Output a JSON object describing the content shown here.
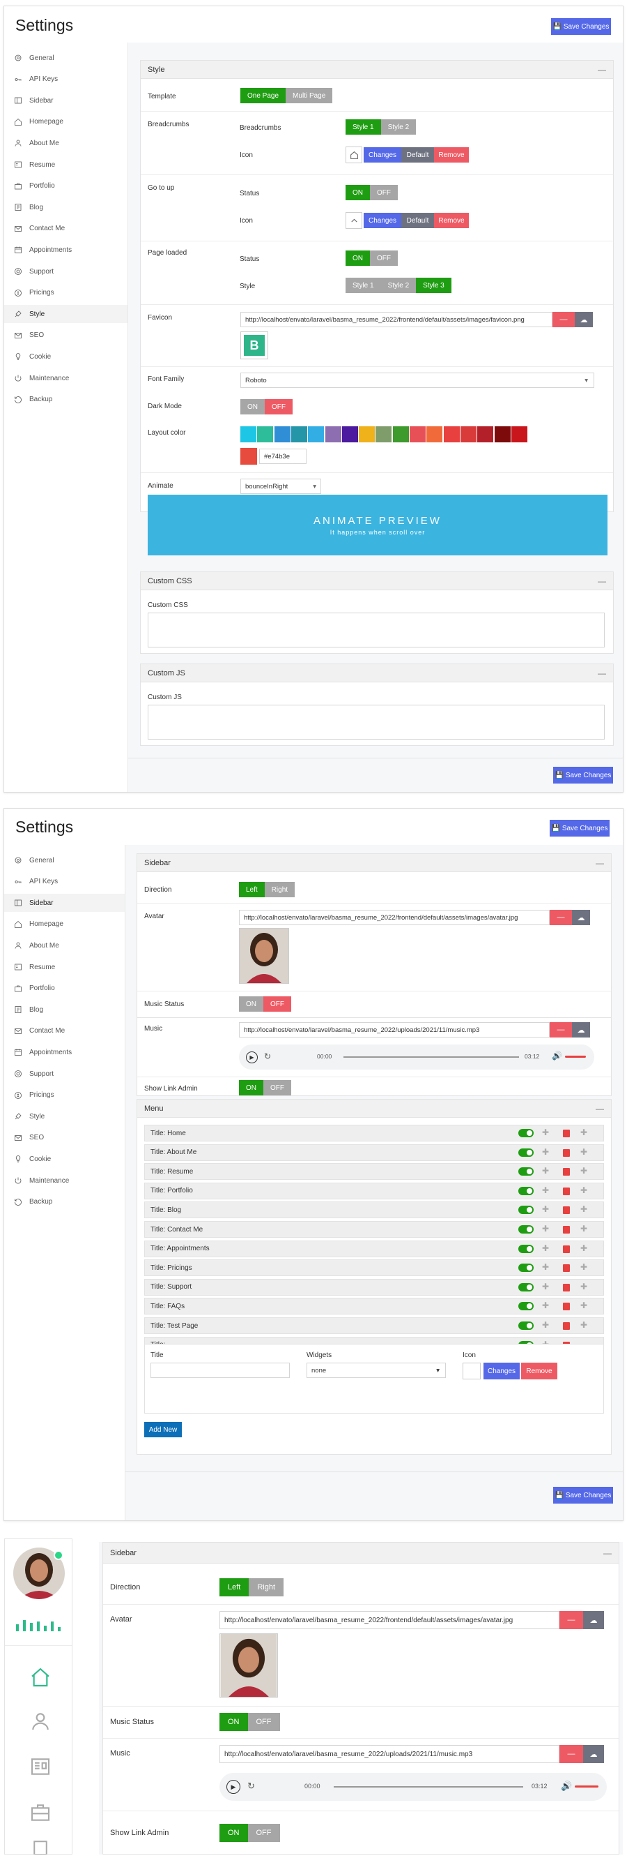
{
  "screen1": {
    "title": "Settings",
    "save_label": "Save Changes",
    "sidebar": [
      "General",
      "API Keys",
      "Sidebar",
      "Homepage",
      "About Me",
      "Resume",
      "Portfolio",
      "Blog",
      "Contact Me",
      "Appointments",
      "Support",
      "Pricings",
      "Style",
      "SEO",
      "Cookie",
      "Maintenance",
      "Backup"
    ],
    "style_card": {
      "title": "Style",
      "template_label": "Template",
      "template_options": [
        "One Page",
        "Multi Page"
      ],
      "breadcrumbs_label": "Breadcrumbs",
      "breadcrumbs_sub": "Breadcrumbs",
      "breadcrumbs_options": [
        "Style 1",
        "Style 2"
      ],
      "icon_label": "Icon",
      "icon_buttons": [
        "Changes",
        "Default",
        "Remove"
      ],
      "goto_label": "Go to up",
      "status_label": "Status",
      "on_off": [
        "ON",
        "OFF"
      ],
      "page_loaded_label": "Page loaded",
      "style_label": "Style",
      "style_options": [
        "Style 1",
        "Style 2",
        "Style 3"
      ],
      "favicon_label": "Favicon",
      "favicon_url": "http://localhost/envato/laravel/basma_resume_2022/frontend/default/assets/images/favicon.png",
      "font_family_label": "Font Family",
      "font_family_value": "Roboto",
      "dark_mode_label": "Dark Mode",
      "layout_color_label": "Layout color",
      "layout_colors": [
        "#1ec6e6",
        "#2ebd9a",
        "#2f8ed6",
        "#2596a8",
        "#33aee5",
        "#8d6eb0",
        "#4b1a9e",
        "#f0b21b",
        "#7e9d6b",
        "#3d9a2d",
        "#e85058",
        "#f16b3a",
        "#e83f3f",
        "#d93a3a",
        "#b4202a",
        "#7d0b0b",
        "#c9151c"
      ],
      "selected_color": "#e74b3e",
      "selected_color_text": "#e74b3e",
      "animate_label": "Animate",
      "animate_value": "bounceInRight",
      "preview_title": "ANIMATE PREVIEW",
      "preview_sub": "It happens when scroll over"
    },
    "css_card": {
      "title": "Custom CSS",
      "label": "Custom CSS"
    },
    "js_card": {
      "title": "Custom JS",
      "label": "Custom JS"
    },
    "colors": {
      "green": "#1f9d12",
      "blue": "#5468e8",
      "red": "#ee5a64",
      "preview": "#3cb4e0"
    }
  },
  "screen2": {
    "title": "Settings",
    "save_label": "Save Changes",
    "sidebar_card": {
      "title": "Sidebar",
      "direction_label": "Direction",
      "direction_options": [
        "Left",
        "Right"
      ],
      "avatar_label": "Avatar",
      "avatar_url": "http://localhost/envato/laravel/basma_resume_2022/frontend/default/assets/images/avatar.jpg",
      "music_status_label": "Music Status",
      "music_label": "Music",
      "music_url": "http://localhost/envato/laravel/basma_resume_2022/uploads/2021/11/music.mp3",
      "audio_current": "00:00",
      "audio_total": "03:12",
      "show_link_label": "Show Link Admin"
    },
    "menu_card": {
      "title": "Menu",
      "items": [
        "Title: Home",
        "Title: About Me",
        "Title: Resume",
        "Title: Portfolio",
        "Title: Blog",
        "Title: Contact Me",
        "Title: Appointments",
        "Title: Pricings",
        "Title: Support",
        "Title: FAQs",
        "Title: Test Page",
        "Title:"
      ],
      "form_title_label": "Title",
      "form_widgets_label": "Widgets",
      "form_widgets_value": "none",
      "form_icon_label": "Icon",
      "add_new_label": "Add New"
    }
  },
  "screen3": {
    "sidebar_card_title": "Sidebar"
  }
}
